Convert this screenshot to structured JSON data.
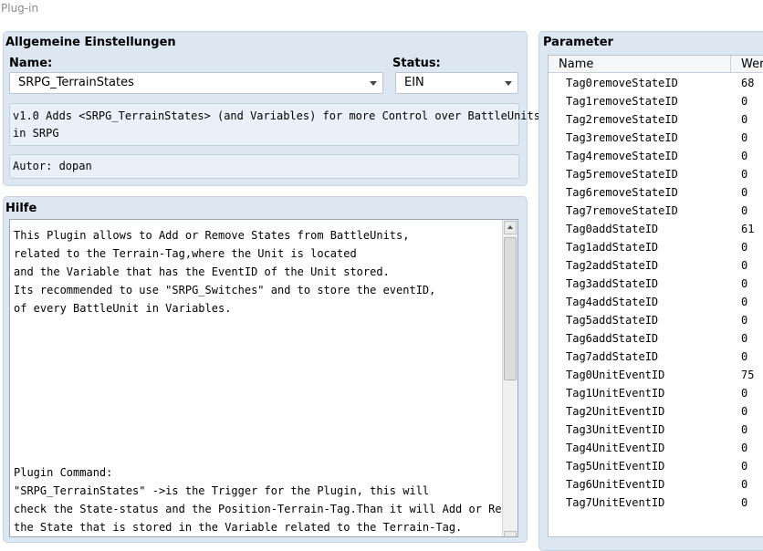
{
  "window": {
    "title": "Plug-in"
  },
  "general": {
    "title": "Allgemeine Einstellungen",
    "name_label": "Name:",
    "name_value": "SRPG_TerrainStates",
    "status_label": "Status:",
    "status_value": "EIN",
    "description": "v1.0 Adds <SRPG_TerrainStates> (and Variables) for more Control over BattleUnits\nin SRPG",
    "author": "Autor: dopan"
  },
  "help": {
    "title": "Hilfe",
    "text": "This Plugin allows to Add or Remove States from BattleUnits,\nrelated to the Terrain-Tag,where the Unit is located\nand the Variable that has the EventID of the Unit stored.\nIts recommended to use \"SRPG_Switches\" and to store the eventID,\nof every BattleUnit in Variables.\n\n\n\n\n\n\n\n\nPlugin Command:\n\"SRPG_TerrainStates\" ->is the Trigger for the Plugin, this will\ncheck the State-status and the Position-Terrain-Tag.Than it will Add or Remove\nthe State that is stored in the Variable related to the Terrain-Tag."
  },
  "parameters": {
    "title": "Parameter",
    "col_name": "Name",
    "col_value": "Wer",
    "rows": [
      {
        "name": "Tag0removeStateID",
        "value": "68"
      },
      {
        "name": "Tag1removeStateID",
        "value": "0"
      },
      {
        "name": "Tag2removeStateID",
        "value": "0"
      },
      {
        "name": "Tag3removeStateID",
        "value": "0"
      },
      {
        "name": "Tag4removeStateID",
        "value": "0"
      },
      {
        "name": "Tag5removeStateID",
        "value": "0"
      },
      {
        "name": "Tag6removeStateID",
        "value": "0"
      },
      {
        "name": "Tag7removeStateID",
        "value": "0"
      },
      {
        "name": "Tag0addStateID",
        "value": "61"
      },
      {
        "name": "Tag1addStateID",
        "value": "0"
      },
      {
        "name": "Tag2addStateID",
        "value": "0"
      },
      {
        "name": "Tag3addStateID",
        "value": "0"
      },
      {
        "name": "Tag4addStateID",
        "value": "0"
      },
      {
        "name": "Tag5addStateID",
        "value": "0"
      },
      {
        "name": "Tag6addStateID",
        "value": "0"
      },
      {
        "name": "Tag7addStateID",
        "value": "0"
      },
      {
        "name": "Tag0UnitEventID",
        "value": "75"
      },
      {
        "name": "Tag1UnitEventID",
        "value": "0"
      },
      {
        "name": "Tag2UnitEventID",
        "value": "0"
      },
      {
        "name": "Tag3UnitEventID",
        "value": "0"
      },
      {
        "name": "Tag4UnitEventID",
        "value": "0"
      },
      {
        "name": "Tag5UnitEventID",
        "value": "0"
      },
      {
        "name": "Tag6UnitEventID",
        "value": "0"
      },
      {
        "name": "Tag7UnitEventID",
        "value": "0"
      }
    ]
  }
}
